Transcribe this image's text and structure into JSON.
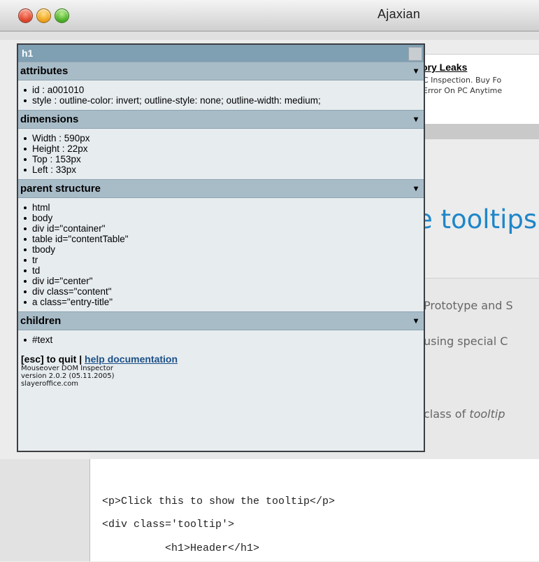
{
  "window": {
    "title": "Ajaxian"
  },
  "background_page": {
    "ad_title": "ory Leaks",
    "ad_line1": "C Inspection. Buy Fo",
    "ad_line2": "Error On PC Anytime",
    "headline": "e tooltips",
    "content_lines": [
      "Prototype and S",
      "using special C"
    ],
    "content_line3_prefix": "class of ",
    "content_line3_italic": "tooltip",
    "code_lines": [
      "<p>Click this to show the tooltip</p>",
      "<div class='tooltip'>",
      "<h1>Header</h1>"
    ]
  },
  "inspector": {
    "title": "h1",
    "sections": {
      "attributes": {
        "label": "attributes",
        "items": [
          "id : a001010",
          "style : outline-color: invert; outline-style: none; outline-width: medium;"
        ]
      },
      "dimensions": {
        "label": "dimensions",
        "items": [
          "Width : 590px",
          "Height : 22px",
          "Top : 153px",
          "Left : 33px"
        ]
      },
      "parent_structure": {
        "label": "parent structure",
        "items": [
          "html",
          "body",
          "div id=\"container\"",
          "table id=\"contentTable\"",
          "tbody",
          "tr",
          "td",
          "div id=\"center\"",
          "div class=\"content\"",
          "a class=\"entry-title\""
        ]
      },
      "children": {
        "label": "children",
        "items": [
          "#text"
        ]
      }
    },
    "footer": {
      "quit_text": "[esc] to quit | ",
      "help_link": "help documentation",
      "line1": "Mouseover DOM Inspector",
      "line2": "version 2.0.2 (05.11.2005)",
      "line3": "slayeroffice.com"
    }
  }
}
